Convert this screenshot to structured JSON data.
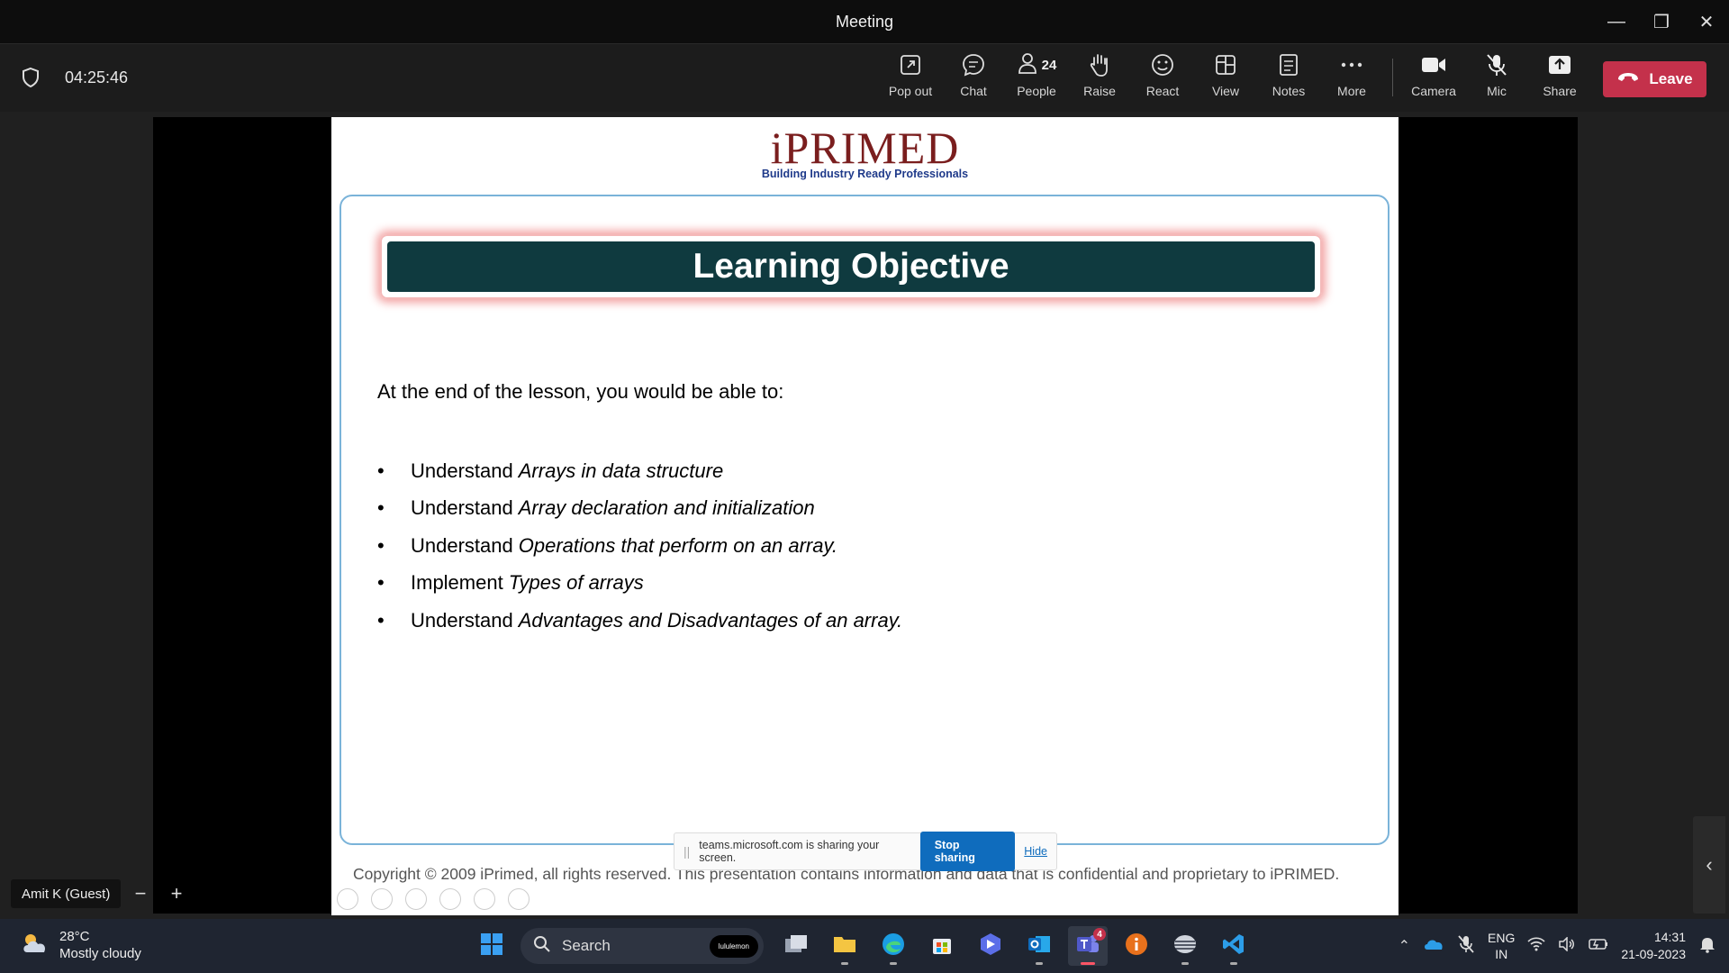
{
  "window": {
    "title": "Meeting"
  },
  "toolbar": {
    "timer": "04:25:46",
    "buttons": [
      {
        "label": "Pop out"
      },
      {
        "label": "Chat"
      },
      {
        "label": "People",
        "count": "24"
      },
      {
        "label": "Raise"
      },
      {
        "label": "React"
      },
      {
        "label": "View"
      },
      {
        "label": "Notes"
      },
      {
        "label": "More"
      },
      {
        "label": "Camera"
      },
      {
        "label": "Mic"
      },
      {
        "label": "Share"
      }
    ],
    "leave_label": "Leave"
  },
  "slide": {
    "logo_brand": "iPRIMED",
    "logo_tagline": "Building Industry Ready Professionals",
    "title": "Learning Objective",
    "intro": "At the end of the lesson, you would be able to:",
    "bullets": [
      {
        "verb": "Understand",
        "topic": "Arrays in data structure"
      },
      {
        "verb": "Understand",
        "topic": "Array declaration and initialization"
      },
      {
        "verb": "Understand",
        "topic": "Operations that perform on an array."
      },
      {
        "verb": "Implement",
        "topic": "Types of arrays"
      },
      {
        "verb": "Understand",
        "topic": "Advantages and Disadvantages of an array."
      }
    ],
    "copyright": "Copyright © 2009 iPrimed, all rights reserved. This presentation contains information  and data  that is confidential and proprietary to iPRIMED."
  },
  "share_bar": {
    "message": "teams.microsoft.com is sharing your screen.",
    "stop_label": "Stop sharing",
    "hide_label": "Hide"
  },
  "participant": {
    "name": "Amit K (Guest)"
  },
  "taskbar": {
    "weather_temp": "28°C",
    "weather_desc": "Mostly cloudy",
    "search_label": "Search",
    "search_pill": "lululemon",
    "teams_badge": "4",
    "lang_line1": "ENG",
    "lang_line2": "IN",
    "time": "14:31",
    "date": "21-09-2023"
  },
  "colors": {
    "leave": "#c4314b",
    "banner": "#0f3a3f",
    "stop_sharing": "#0f6cbd",
    "brand": "#7a1e1e"
  }
}
